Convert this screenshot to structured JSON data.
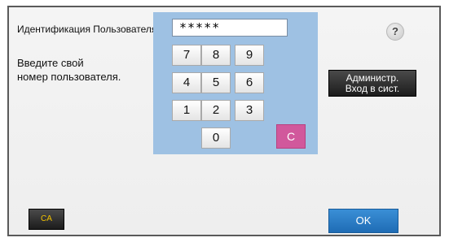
{
  "user_id": {
    "label": "Идентификация Пользователя",
    "masked_value": "*****"
  },
  "prompt": {
    "line1": "Введите свой",
    "line2": "номер пользователя."
  },
  "keypad": {
    "keys": [
      "7",
      "8",
      "9",
      "4",
      "5",
      "6",
      "1",
      "2",
      "3",
      "0"
    ],
    "clear_label": "C"
  },
  "help": {
    "label": "?"
  },
  "admin_button": {
    "line1": "Администр.",
    "line2": "Вход в сист."
  },
  "ca_button": {
    "label": "CA"
  },
  "ok_button": {
    "label": "OK"
  },
  "colors": {
    "keypad_background": "#9ec1e3",
    "clear_key": "#d1589c",
    "ok_button": "#2a7cc7",
    "ca_text": "#f2c200"
  }
}
